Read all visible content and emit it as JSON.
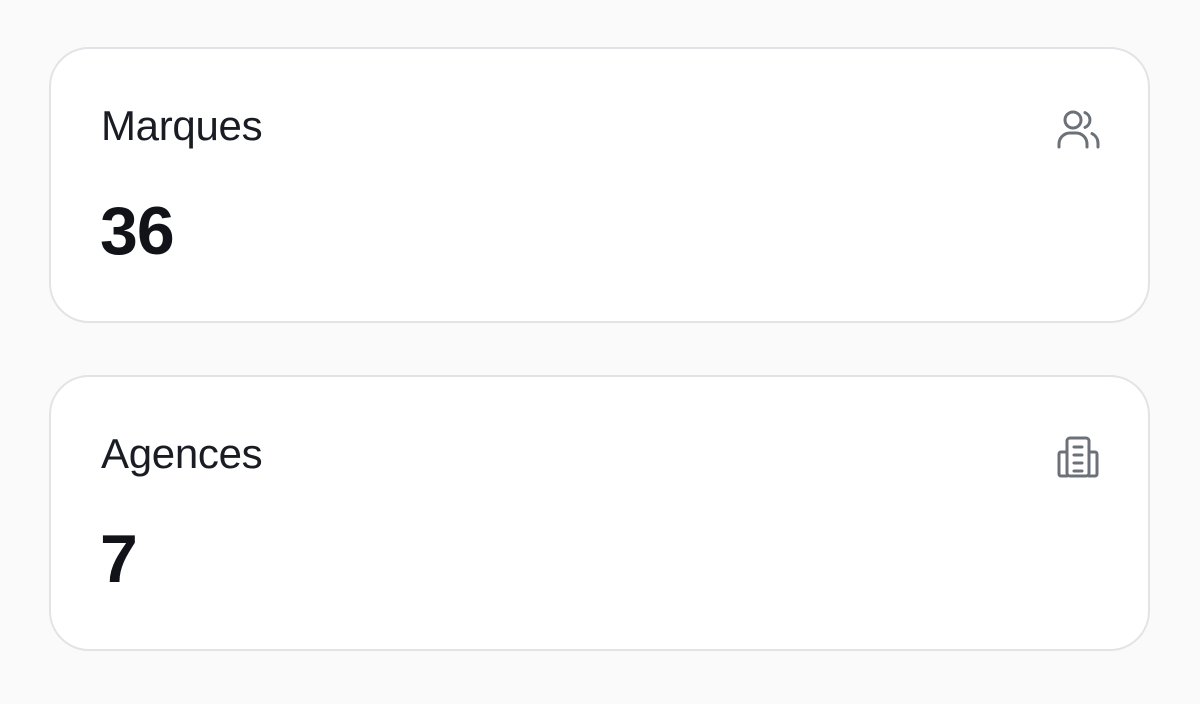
{
  "cards": [
    {
      "title": "Marques",
      "value": "36",
      "icon": "users-icon"
    },
    {
      "title": "Agences",
      "value": "7",
      "icon": "building-icon"
    }
  ],
  "colors": {
    "page_background": "#fafafa",
    "card_background": "#ffffff",
    "card_border": "#e2e3e6",
    "text_primary": "#121319",
    "icon_color": "#6b7079"
  }
}
